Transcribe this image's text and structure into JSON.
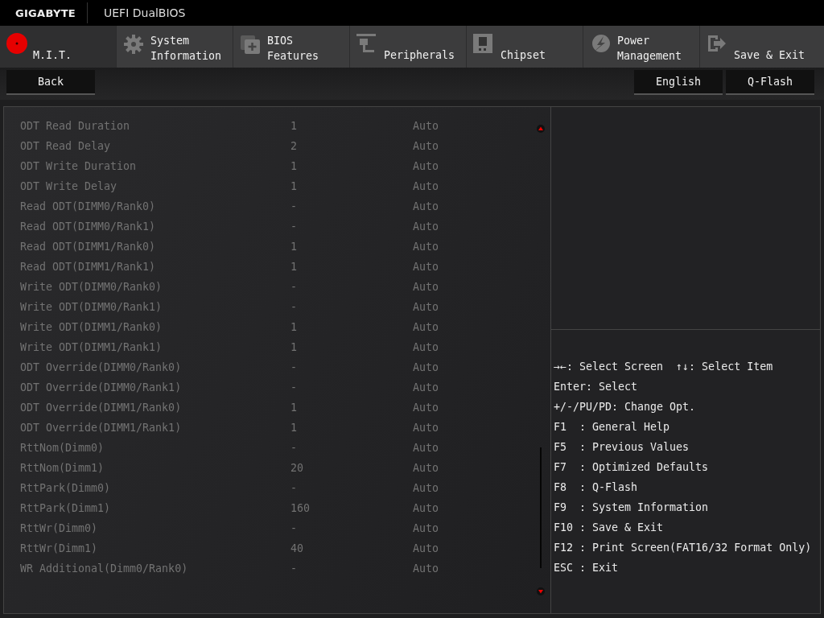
{
  "header": {
    "brand": "GIGABYTE",
    "title": "UEFI DualBIOS"
  },
  "tabs": [
    {
      "lines": [
        "M.I.T."
      ],
      "selected": true
    },
    {
      "lines": [
        "System",
        "Information"
      ],
      "selected": false
    },
    {
      "lines": [
        "BIOS",
        "Features"
      ],
      "selected": false
    },
    {
      "lines": [
        "Peripherals"
      ],
      "selected": false
    },
    {
      "lines": [
        "Chipset"
      ],
      "selected": false
    },
    {
      "lines": [
        "Power",
        "Management"
      ],
      "selected": false
    },
    {
      "lines": [
        "Save & Exit"
      ],
      "selected": false
    }
  ],
  "buttons_left": [
    "Back"
  ],
  "buttons_right": [
    "English",
    "Q-Flash"
  ],
  "settings": [
    {
      "name": "ODT Read Duration",
      "value": "1",
      "option": "Auto",
      "disabled": true
    },
    {
      "name": "ODT Read Delay",
      "value": "2",
      "option": "Auto",
      "disabled": true
    },
    {
      "name": "ODT Write Duration",
      "value": "1",
      "option": "Auto",
      "disabled": true
    },
    {
      "name": "ODT Write Delay",
      "value": "1",
      "option": "Auto",
      "disabled": true
    },
    {
      "name": "Read ODT(DIMM0/Rank0)",
      "value": "-",
      "option": "Auto",
      "disabled": true
    },
    {
      "name": "Read ODT(DIMM0/Rank1)",
      "value": "-",
      "option": "Auto",
      "disabled": true
    },
    {
      "name": "Read ODT(DIMM1/Rank0)",
      "value": "1",
      "option": "Auto",
      "disabled": true
    },
    {
      "name": "Read ODT(DIMM1/Rank1)",
      "value": "1",
      "option": "Auto",
      "disabled": true
    },
    {
      "name": "Write ODT(DIMM0/Rank0)",
      "value": "-",
      "option": "Auto",
      "disabled": true
    },
    {
      "name": "Write ODT(DIMM0/Rank1)",
      "value": "-",
      "option": "Auto",
      "disabled": true
    },
    {
      "name": "Write ODT(DIMM1/Rank0)",
      "value": "1",
      "option": "Auto",
      "disabled": true
    },
    {
      "name": "Write ODT(DIMM1/Rank1)",
      "value": "1",
      "option": "Auto",
      "disabled": true
    },
    {
      "name": "ODT Override(DIMM0/Rank0)",
      "value": "-",
      "option": "Auto",
      "disabled": true
    },
    {
      "name": "ODT Override(DIMM0/Rank1)",
      "value": "-",
      "option": "Auto",
      "disabled": true
    },
    {
      "name": "ODT Override(DIMM1/Rank0)",
      "value": "1",
      "option": "Auto",
      "disabled": true
    },
    {
      "name": "ODT Override(DIMM1/Rank1)",
      "value": "1",
      "option": "Auto",
      "disabled": true
    },
    {
      "name": "RttNom(Dimm0)",
      "value": "-",
      "option": "Auto",
      "disabled": true
    },
    {
      "name": "RttNom(Dimm1)",
      "value": "20",
      "option": "Auto",
      "disabled": true
    },
    {
      "name": "RttPark(Dimm0)",
      "value": "-",
      "option": "Auto",
      "disabled": true
    },
    {
      "name": "RttPark(Dimm1)",
      "value": "160",
      "option": "Auto",
      "disabled": true
    },
    {
      "name": "RttWr(Dimm0)",
      "value": "-",
      "option": "Auto",
      "disabled": true
    },
    {
      "name": "RttWr(Dimm1)",
      "value": "40",
      "option": "Auto",
      "disabled": true
    },
    {
      "name": "WR Additional(Dimm0/Rank0)",
      "value": "-",
      "option": "Auto",
      "disabled": true
    }
  ],
  "help": [
    [
      "→←: Select Screen",
      "↑↓: Select Item"
    ],
    [
      "Enter: Select"
    ],
    [
      "+/-/PU/PD: Change Opt."
    ],
    [
      "F1  : General Help"
    ],
    [
      "F5  : Previous Values"
    ],
    [
      "F7  : Optimized Defaults"
    ],
    [
      "F8  : Q-Flash"
    ],
    [
      "F9  : System Information"
    ],
    [
      "F10 : Save & Exit"
    ],
    [
      "F12 : Print Screen(FAT16/32 Format Only)"
    ],
    [
      "ESC : Exit"
    ]
  ]
}
